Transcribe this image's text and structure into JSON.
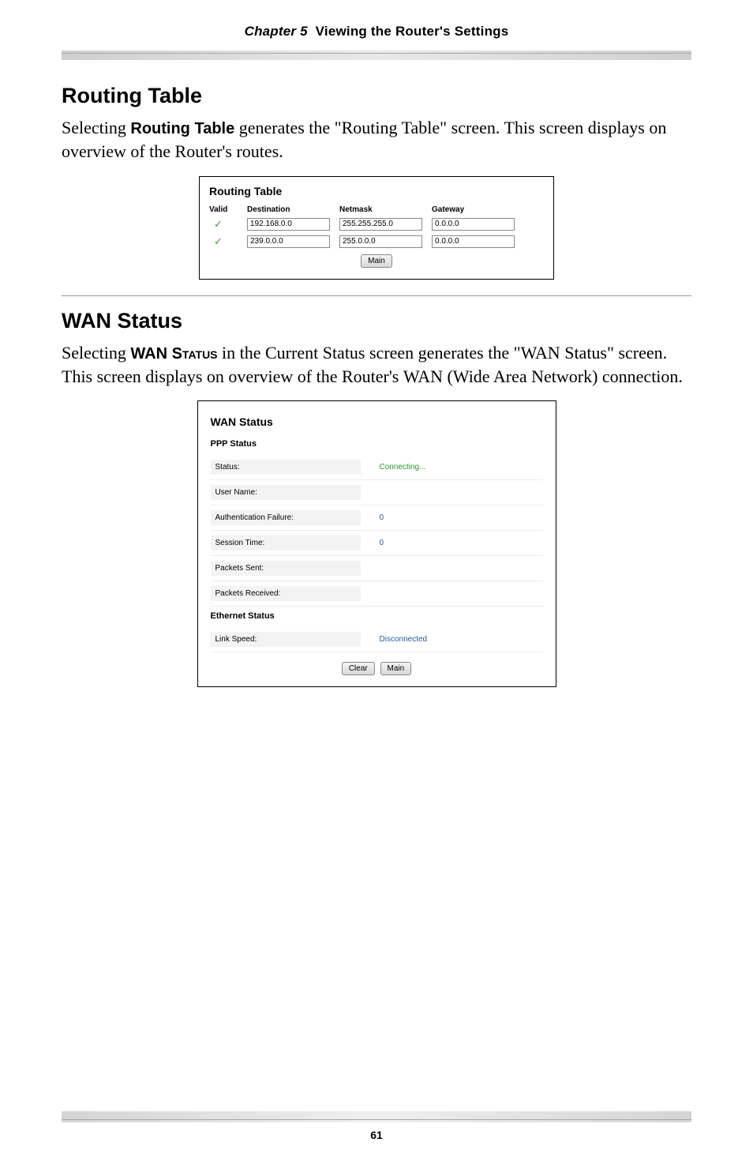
{
  "header": {
    "chapter": "Chapter 5",
    "title": "Viewing the Router's Settings"
  },
  "section1": {
    "heading": "Routing Table",
    "para_part1": "Selecting ",
    "para_bold": "Routing Table",
    "para_part2": " generates the \"Routing Table\" screen. This screen displays on overview of the Router's routes."
  },
  "routing_table": {
    "title": "Routing Table",
    "columns": {
      "valid": "Valid",
      "dest": "Destination",
      "mask": "Netmask",
      "gw": "Gateway"
    },
    "rows": [
      {
        "check": "✓",
        "dest": "192.168.0.0",
        "mask": "255.255.255.0",
        "gw": "0.0.0.0"
      },
      {
        "check": "✓",
        "dest": "239.0.0.0",
        "mask": "255.0.0.0",
        "gw": "0.0.0.0"
      }
    ],
    "main_btn": "Main"
  },
  "section2": {
    "heading": "WAN Status",
    "para_part1": "Selecting ",
    "para_bold": "WAN Status",
    "para_part2": " in the Current Status screen generates the \"",
    "para_sc1": "WAN",
    "para_part3": " Status\" screen. This screen displays on overview of the Router's ",
    "para_sc2": "WAN",
    "para_part4": " (Wide Area Network) connection."
  },
  "wan_status": {
    "title": "WAN Status",
    "ppp_title": "PPP Status",
    "rows_ppp": [
      {
        "label": "Status:",
        "value": "Connecting...",
        "cls": "green"
      },
      {
        "label": "User Name:",
        "value": "",
        "cls": ""
      },
      {
        "label": "Authentication Failure:",
        "value": "0",
        "cls": "blue"
      },
      {
        "label": "Session Time:",
        "value": "0",
        "cls": "blue"
      },
      {
        "label": "Packets Sent:",
        "value": "",
        "cls": ""
      },
      {
        "label": "Packets Received:",
        "value": "",
        "cls": ""
      }
    ],
    "eth_title": "Ethernet Status",
    "rows_eth": [
      {
        "label": "Link Speed:",
        "value": "Disconnected",
        "cls": "blue"
      }
    ],
    "clear_btn": "Clear",
    "main_btn": "Main"
  },
  "footer": {
    "page": "61"
  }
}
